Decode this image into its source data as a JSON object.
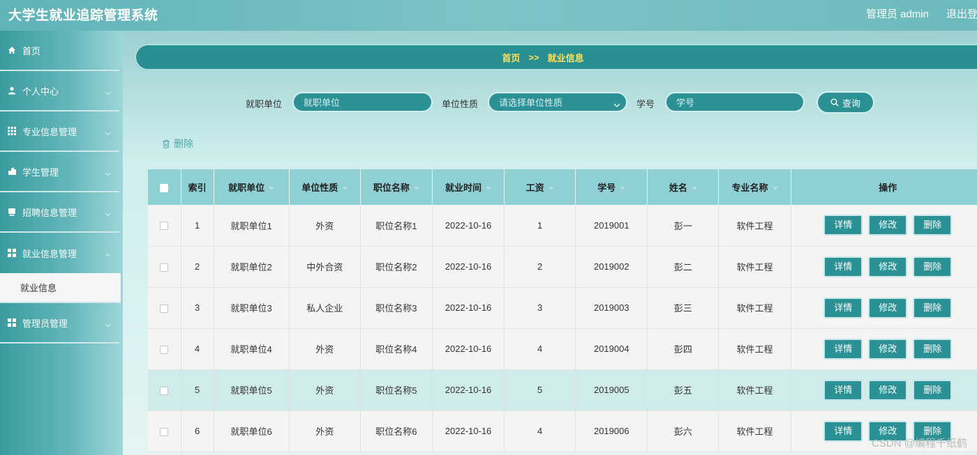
{
  "app": {
    "title": "大学生就业追踪管理系统",
    "user": "管理员 admin",
    "logout": "退出登"
  },
  "sidebar": {
    "items": [
      {
        "label": "首页",
        "icon": "home-icon"
      },
      {
        "label": "个人中心",
        "icon": "user-icon"
      },
      {
        "label": "专业信息管理",
        "icon": "grid-icon"
      },
      {
        "label": "学生管理",
        "icon": "student-icon"
      },
      {
        "label": "招聘信息管理",
        "icon": "recruit-icon"
      },
      {
        "label": "就业信息管理",
        "icon": "grid-icon"
      }
    ],
    "active_sub": "就业信息",
    "last_item": {
      "label": "管理员管理",
      "icon": "grid-icon"
    }
  },
  "breadcrumb": {
    "home": "首页",
    "sep": ">>",
    "current": "就业信息"
  },
  "search": {
    "employer_label": "就职单位",
    "employer_placeholder": "就职单位",
    "nature_label": "单位性质",
    "nature_placeholder": "请选择单位性质",
    "id_label": "学号",
    "id_placeholder": "学号",
    "query": "查询"
  },
  "toolbar": {
    "delete": "删除"
  },
  "table": {
    "headers": [
      "索引",
      "就职单位",
      "单位性质",
      "职位名称",
      "就业时间",
      "工资",
      "学号",
      "姓名",
      "专业名称",
      "操作"
    ],
    "actions": {
      "detail": "详情",
      "edit": "修改",
      "delete": "删除"
    },
    "rows": [
      [
        "1",
        "就职单位1",
        "外资",
        "职位名称1",
        "2022-10-16",
        "1",
        "2019001",
        "彭一",
        "软件工程"
      ],
      [
        "2",
        "就职单位2",
        "中外合资",
        "职位名称2",
        "2022-10-16",
        "2",
        "2019002",
        "彭二",
        "软件工程"
      ],
      [
        "3",
        "就职单位3",
        "私人企业",
        "职位名称3",
        "2022-10-16",
        "3",
        "2019003",
        "彭三",
        "软件工程"
      ],
      [
        "4",
        "就职单位4",
        "外资",
        "职位名称4",
        "2022-10-16",
        "4",
        "2019004",
        "彭四",
        "软件工程"
      ],
      [
        "5",
        "就职单位5",
        "外资",
        "职位名称5",
        "2022-10-16",
        "5",
        "2019005",
        "彭五",
        "软件工程"
      ],
      [
        "6",
        "就职单位6",
        "外资",
        "职位名称6",
        "2022-10-16",
        "4",
        "2019006",
        "彭六",
        "软件工程"
      ]
    ]
  },
  "watermark": "CSDN @编程千纸鹤",
  "colors": {
    "accent": "#2b9195",
    "crumb_text": "#ffe05a",
    "header_bg": "#8ed0d3"
  }
}
